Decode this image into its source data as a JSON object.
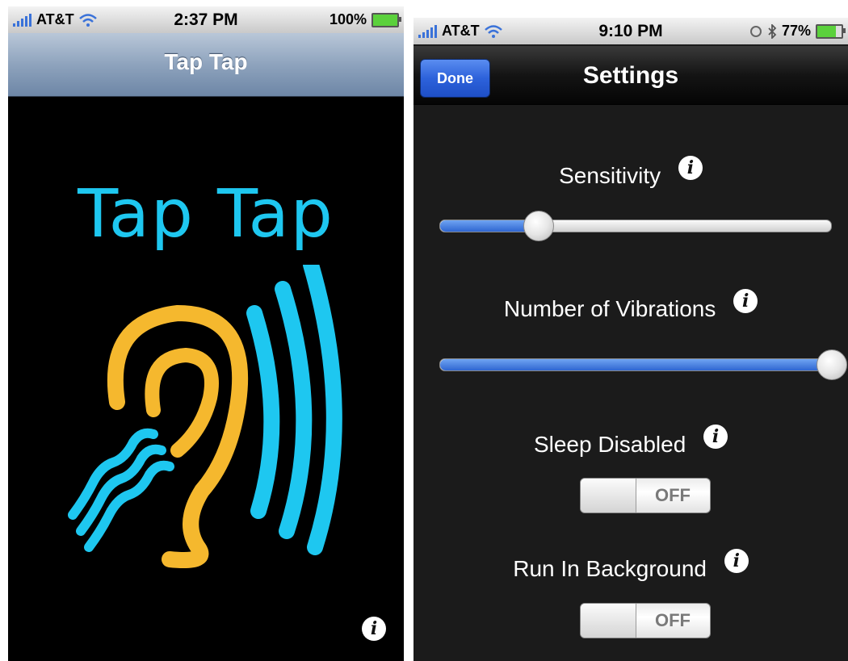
{
  "left_screen": {
    "status": {
      "carrier": "AT&T",
      "time": "2:37 PM",
      "battery": "100%"
    },
    "nav_title": "Tap Tap",
    "logo_text": "Tap Tap",
    "info_icon": "info-icon",
    "colors": {
      "logo": "#1ec7f0",
      "ear": "#f5b82e"
    }
  },
  "right_screen": {
    "status": {
      "carrier": "AT&T",
      "time": "9:10 PM",
      "battery": "77%"
    },
    "nav_title": "Settings",
    "done_label": "Done",
    "settings": [
      {
        "label": "Sensitivity",
        "type": "slider",
        "value": 0.25
      },
      {
        "label": "Number of Vibrations",
        "type": "slider",
        "value": 1.0
      },
      {
        "label": "Sleep Disabled",
        "type": "toggle",
        "state": "OFF"
      },
      {
        "label": "Run In Background",
        "type": "toggle",
        "state": "OFF"
      }
    ],
    "colors": {
      "done_button": "#2d62db",
      "slider_fill": "#2f66d1"
    }
  }
}
